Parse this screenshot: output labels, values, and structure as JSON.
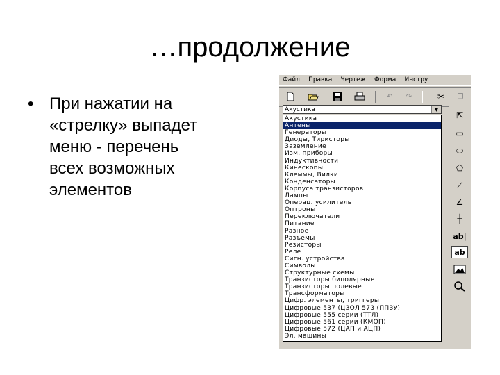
{
  "slide": {
    "title": "…продолжение",
    "bullet_marker": "•",
    "bullet_text": "При нажатии на\n«стрелку» выпадет\nменю - перечень\nвсех возможных\nэлементов"
  },
  "app": {
    "menu": [
      "Файл",
      "Правка",
      "Чертеж",
      "Форма",
      "Инстру"
    ],
    "toolbar_icons": [
      "new-file-icon",
      "open-folder-icon",
      "save-icon",
      "print-icon",
      "undo-icon",
      "redo-icon",
      "cut-icon",
      "copy-icon"
    ],
    "combo": {
      "value": "Акустика",
      "arrow": "▼"
    },
    "dropdown_items": [
      "Акустика",
      "Антены",
      "Генераторы",
      "Диоды, Тиристоры",
      "Заземление",
      "Изм. приборы",
      "Индуктивности",
      "Кинескопы",
      "Клеммы, Вилки",
      "Конденсаторы",
      "Корпуса транзисторов",
      "Лампы",
      "Операц. усилитель",
      "Оптроны",
      "Переключатели",
      "Питание",
      "Разное",
      "Разъёмы",
      "Резисторы",
      "Реле",
      "Сигн. устройства",
      "Символы",
      "Структурные схемы",
      "Транзисторы биполярные",
      "Транзисторы полевые",
      "Трансформаторы",
      "Цифр. элементы, триггеры",
      "Цифровые 537 (ЦЗОЛ 573 (ППЗУ)",
      "Цифровые 555 серии (ТТЛ)",
      "Цифровые 561 серии (КМОП)",
      "Цифровые 572 (ЦАП и АЦП)",
      "Эл. машины"
    ],
    "selected_index": 1,
    "palette": {
      "pointer": "⇱",
      "rect": "▭",
      "ellipse": "⬭",
      "polygon": "⬠",
      "line": "⟋",
      "curve": "∠",
      "node": "┼",
      "text_label": "ab|",
      "text_box": "ab"
    }
  }
}
